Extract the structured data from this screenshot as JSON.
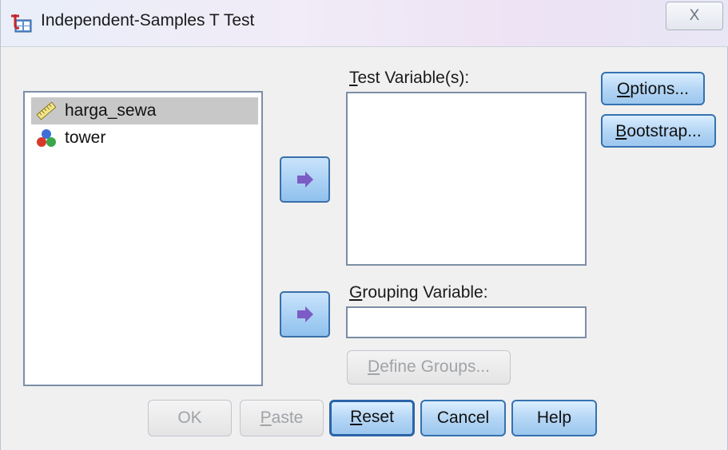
{
  "window": {
    "title": "Independent-Samples T Test",
    "close_glyph": "X"
  },
  "source_variables": [
    {
      "label": "harga_sewa",
      "icon": "scale-ruler-icon",
      "selected": true
    },
    {
      "label": "tower",
      "icon": "nominal-balls-icon",
      "selected": false
    }
  ],
  "test_variables": {
    "label_prefix": "",
    "label_mnemonic": "T",
    "label_rest": "est Variable(s):",
    "items": []
  },
  "grouping_variable": {
    "label_mnemonic": "G",
    "label_rest": "rouping Variable:",
    "value": ""
  },
  "side_buttons": {
    "options": {
      "mnemonic": "O",
      "rest": "ptions..."
    },
    "bootstrap": {
      "mnemonic": "B",
      "rest": "ootstrap..."
    }
  },
  "define_groups": {
    "mnemonic": "D",
    "rest": "efine Groups...",
    "enabled": false
  },
  "footer_buttons": {
    "ok": {
      "label": "OK",
      "enabled": false
    },
    "paste": {
      "mnemonic": "P",
      "rest": "aste",
      "enabled": false
    },
    "reset": {
      "mnemonic": "R",
      "rest": "eset",
      "enabled": true
    },
    "cancel": {
      "label": "Cancel",
      "enabled": true
    },
    "help": {
      "label": "Help",
      "enabled": true
    }
  },
  "colors": {
    "accent_border": "#3572b0",
    "button_gradient_top": "#dbeeff",
    "button_gradient_bottom": "#9cc7ee",
    "arrow": "#7b5cc4",
    "selection": "#c8c8c8"
  }
}
